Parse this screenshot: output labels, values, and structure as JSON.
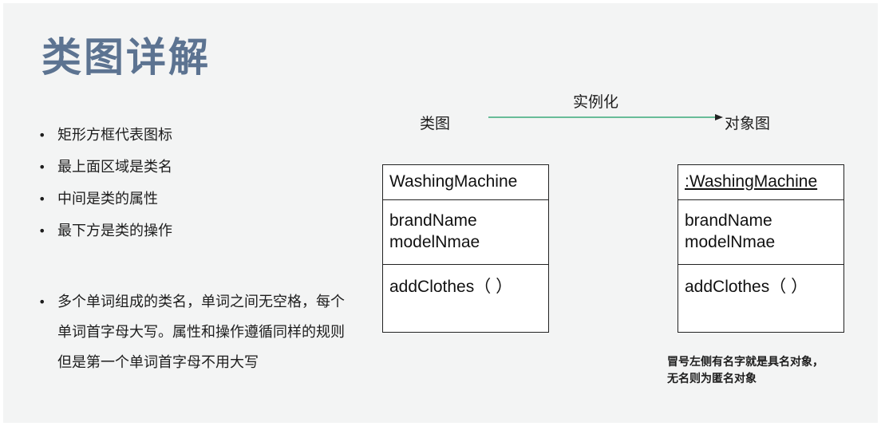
{
  "slide": {
    "title": "类图详解",
    "bullets": [
      "矩形方框代表图标",
      "最上面区域是类名",
      "中间是类的属性",
      "最下方是类的操作"
    ],
    "paragraph": "多个单词组成的类名，单词之间无空格，每个单词首字母大写。属性和操作遵循同样的规则但是第一个单词首字母不用大写"
  },
  "diagram": {
    "left_label": "类图",
    "arrow_label": "实例化",
    "right_label": "对象图",
    "arrow_color": "#3aaa7a",
    "class_box": {
      "name": "WashingMachine",
      "attributes": [
        "brandName",
        "modelNmae"
      ],
      "operation": "addClothes（ ）"
    },
    "object_box": {
      "name": ":WashingMachine",
      "attributes": [
        "brandName",
        "modelNmae"
      ],
      "operation": "addClothes（ ）"
    },
    "note_lines": [
      "冒号左侧有名字就是具名对象，",
      "无名则为匿名对象"
    ]
  }
}
